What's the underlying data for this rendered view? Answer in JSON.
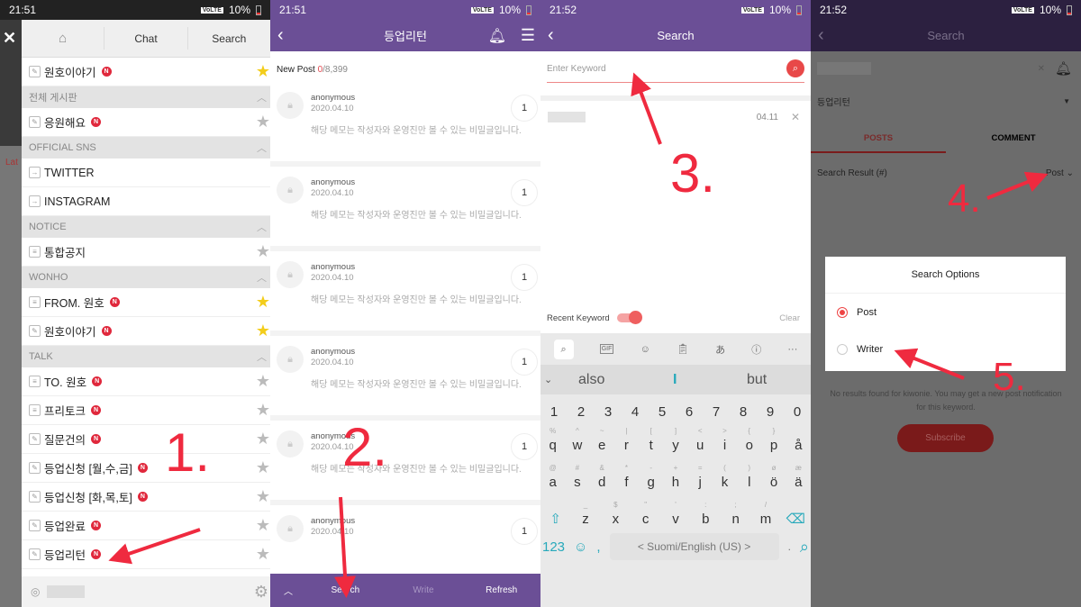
{
  "accent": {
    "purple": "#6b4f96",
    "red": "#e0283c",
    "annotation": "#ef2a3f"
  },
  "panel1": {
    "status": {
      "time": "21:51",
      "battery": "10%"
    },
    "header": {
      "home_icon": "home-icon",
      "chat": "Chat",
      "search": "Search"
    },
    "behind_tab": "Lat",
    "list": [
      {
        "type": "item",
        "label": "원호이야기",
        "icon": "pencil",
        "new": true,
        "star": "yellow"
      },
      {
        "type": "section",
        "label": "전체 게시판"
      },
      {
        "type": "item",
        "label": "응원해요",
        "icon": "pencil",
        "new": true,
        "star": "grey"
      },
      {
        "type": "section",
        "label": "OFFICIAL SNS"
      },
      {
        "type": "item",
        "label": "TWITTER",
        "icon": "link"
      },
      {
        "type": "item",
        "label": "INSTAGRAM",
        "icon": "link"
      },
      {
        "type": "section",
        "label": "NOTICE"
      },
      {
        "type": "item",
        "label": "통합공지",
        "icon": "list",
        "star": "grey"
      },
      {
        "type": "section",
        "label": "WONHO"
      },
      {
        "type": "item",
        "label": "FROM. 원호",
        "icon": "list",
        "new": true,
        "star": "yellow"
      },
      {
        "type": "item",
        "label": "원호이야기",
        "icon": "pencil",
        "new": true,
        "star": "yellow"
      },
      {
        "type": "section",
        "label": "TALK"
      },
      {
        "type": "item",
        "label": "TO. 원호",
        "icon": "list",
        "new": true,
        "star": "grey"
      },
      {
        "type": "item",
        "label": "프리토크",
        "icon": "list",
        "new": true,
        "star": "grey"
      },
      {
        "type": "item",
        "label": "질문건의",
        "icon": "pencil",
        "new": true,
        "star": "grey"
      },
      {
        "type": "item",
        "label": "등업신청 [월,수,금]",
        "icon": "pencil",
        "new": true,
        "star": "grey"
      },
      {
        "type": "item",
        "label": "등업신청 [화,목,토]",
        "icon": "pencil",
        "new": true,
        "star": "grey"
      },
      {
        "type": "item",
        "label": "등업완료",
        "icon": "pencil",
        "new": true,
        "star": "grey"
      },
      {
        "type": "item",
        "label": "등업리턴",
        "icon": "pencil",
        "new": true,
        "star": "grey"
      }
    ],
    "new_badge": "N"
  },
  "panel2": {
    "status": {
      "time": "21:51",
      "battery": "10%"
    },
    "title": "등업리턴",
    "new_post_label": "New Post ",
    "new_post_count": "0",
    "new_post_total": "/8,399",
    "posts": [
      {
        "author": "anonymous",
        "date": "2020.04.10",
        "text": "해당 메모는 작성자와 운영진만 볼 수 있는 비밀글입니다.",
        "count": "1"
      },
      {
        "author": "anonymous",
        "date": "2020.04.10",
        "text": "해당 메모는 작성자와 운영진만 볼 수 있는 비밀글입니다.",
        "count": "1"
      },
      {
        "author": "anonymous",
        "date": "2020.04.10",
        "text": "해당 메모는 작성자와 운영진만 볼 수 있는 비밀글입니다.",
        "count": "1"
      },
      {
        "author": "anonymous",
        "date": "2020.04.10",
        "text": "해당 메모는 작성자와 운영진만 볼 수 있는 비밀글입니다.",
        "count": "1"
      },
      {
        "author": "anonymous",
        "date": "2020.04.10",
        "text": "해당 메모는 작성자와 운영진만 볼 수 있는 비밀글입니다.",
        "count": "1"
      },
      {
        "author": "anonymous",
        "date": "2020.04.10",
        "text": "",
        "count": "1"
      }
    ],
    "footer": {
      "search": "Search",
      "write": "Write",
      "refresh": "Refresh"
    }
  },
  "panel3": {
    "status": {
      "time": "21:52",
      "battery": "10%"
    },
    "title": "Search",
    "keyword_placeholder": "Enter Keyword",
    "recent_date": "04.11",
    "recent_keyword_label": "Recent Keyword",
    "recent_keyword_enabled": true,
    "clear": "Clear",
    "keyboard": {
      "suggestions": [
        "also",
        "I",
        "but"
      ],
      "numbers": [
        "1",
        "2",
        "3",
        "4",
        "5",
        "6",
        "7",
        "8",
        "9",
        "0"
      ],
      "row1": [
        "q",
        "w",
        "e",
        "r",
        "t",
        "y",
        "u",
        "i",
        "o",
        "p",
        "å"
      ],
      "row1_alt": [
        "%",
        "^",
        "~",
        "|",
        "[",
        "]",
        "<",
        ">",
        "{",
        "}",
        ""
      ],
      "row2": [
        "a",
        "s",
        "d",
        "f",
        "g",
        "h",
        "j",
        "k",
        "l",
        "ö",
        "ä"
      ],
      "row2_alt": [
        "@",
        "#",
        "&",
        "*",
        "-",
        "+",
        "=",
        "(",
        ")",
        "ø",
        "æ"
      ],
      "row3": [
        "z",
        "x",
        "c",
        "v",
        "b",
        "n",
        "m"
      ],
      "row3_alt": [
        "_",
        "$",
        "\"",
        "'",
        ":",
        ";",
        "/"
      ],
      "mode": "123",
      "comma": ",",
      "space": "< Suomi/English (US) >",
      "period": "."
    }
  },
  "panel4": {
    "status": {
      "time": "21:52",
      "battery": "10%"
    },
    "title": "Search",
    "board": "등업리턴",
    "tabs": [
      "POSTS",
      "COMMENT"
    ],
    "result_label": "Search Result (#)",
    "filter": "Post",
    "dialog": {
      "title": "Search Options",
      "options": [
        {
          "label": "Post",
          "selected": true
        },
        {
          "label": "Writer",
          "selected": false
        }
      ]
    },
    "no_results": "No results found for kiwonie. You may get a new post notification for this keyword.",
    "subscribe": "Subscribe"
  },
  "annotations": [
    "1.",
    "2.",
    "3.",
    "4.",
    "5."
  ]
}
